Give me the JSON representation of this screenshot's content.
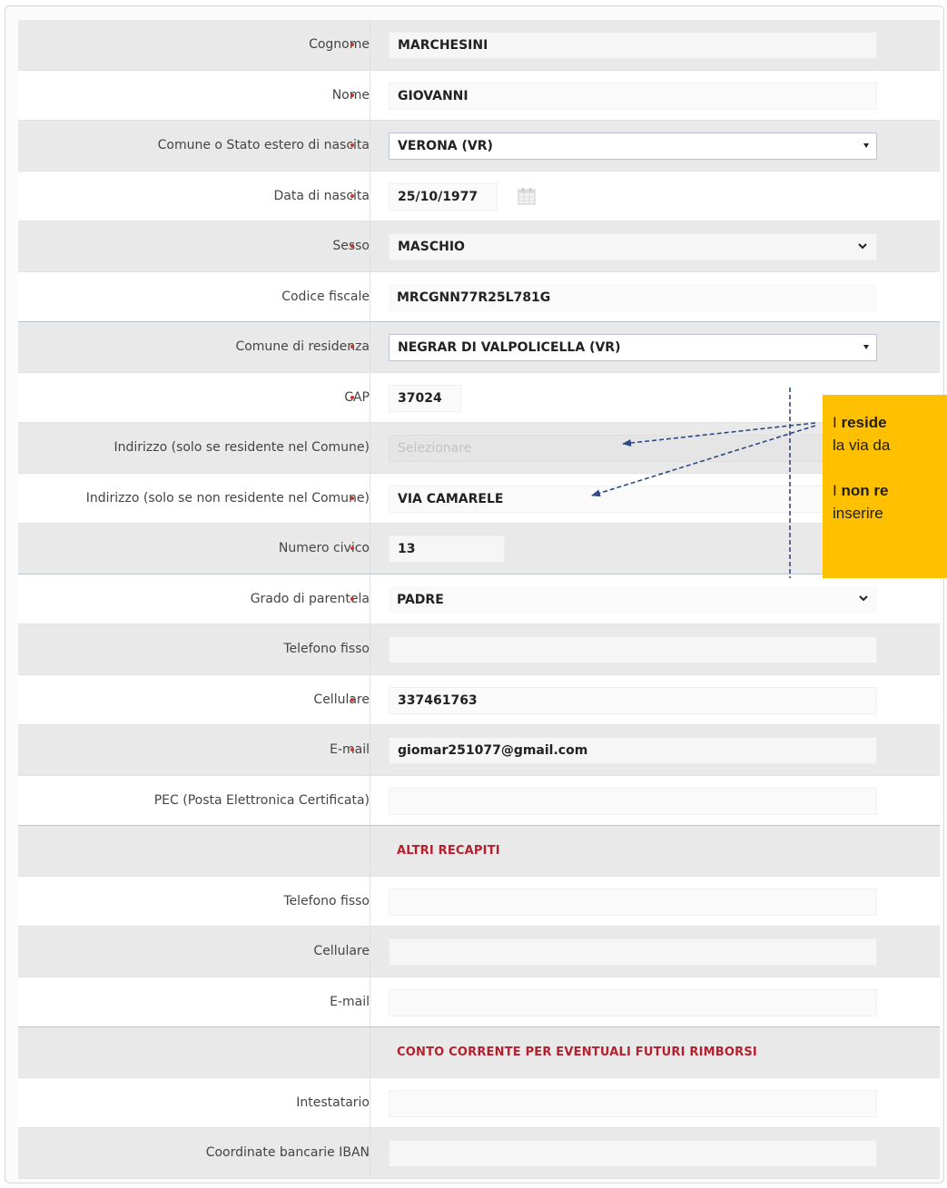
{
  "form": {
    "rows": [
      {
        "label": "Cognome",
        "required": true,
        "value": "MARCHESINI"
      },
      {
        "label": "Nome",
        "required": true,
        "value": "GIOVANNI"
      },
      {
        "label": "Comune o Stato estero di nascita",
        "required": true,
        "value": "VERONA (VR)"
      },
      {
        "label": "Data di nascita",
        "required": true,
        "value": "25/10/1977"
      },
      {
        "label": "Sesso",
        "required": true,
        "value": "MASCHIO"
      },
      {
        "label": "Codice fiscale",
        "required": false,
        "value": "MRCGNN77R25L781G"
      },
      {
        "label": "Comune di residenza",
        "required": true,
        "value": "NEGRAR DI VALPOLICELLA (VR)"
      },
      {
        "label": "CAP",
        "required": true,
        "value": "37024"
      },
      {
        "label": "Indirizzo (solo se residente nel Comune)",
        "required": false,
        "placeholder": "Selezionare"
      },
      {
        "label": "Indirizzo (solo se non residente nel Comune)",
        "required": true,
        "value": "VIA CAMARELE"
      },
      {
        "label": "Numero civico",
        "required": true,
        "value": "13"
      },
      {
        "label": "Grado di parentela",
        "required": true,
        "value": "PADRE"
      },
      {
        "label": "Telefono fisso",
        "required": false,
        "value": ""
      },
      {
        "label": "Cellulare",
        "required": true,
        "value": "337461763"
      },
      {
        "label": "E-mail",
        "required": true,
        "value": "giomar251077@gmail.com"
      },
      {
        "label": "PEC (Posta Elettronica Certificata)",
        "required": false,
        "value": ""
      }
    ],
    "altri_recapiti": {
      "title": "ALTRI RECAPITI",
      "rows": [
        {
          "label": "Telefono fisso",
          "value": ""
        },
        {
          "label": "Cellulare",
          "value": ""
        },
        {
          "label": "E-mail",
          "value": ""
        }
      ]
    },
    "conto_corrente": {
      "title": "CONTO CORRENTE PER EVENTUALI FUTURI RIMBORSI",
      "rows": [
        {
          "label": "Intestatario",
          "value": ""
        },
        {
          "label": "Coordinate bancarie IBAN",
          "value": ""
        }
      ]
    }
  },
  "icons": {
    "required": "required-asterisk-icon",
    "dropdown": "dropdown-caret-icon",
    "chevron": "chevron-down-icon",
    "calendar": "calendar-icon"
  },
  "colors": {
    "required": "#c0392b",
    "section_title": "#b5202e",
    "note_background": "#ffc000",
    "arrow": "#2e4a86"
  },
  "note": {
    "line1_prefix": "I ",
    "line1_bold": "reside",
    "line2": "la via da",
    "line3_prefix": "I ",
    "line3_bold": "non re",
    "line4": "inserire"
  }
}
